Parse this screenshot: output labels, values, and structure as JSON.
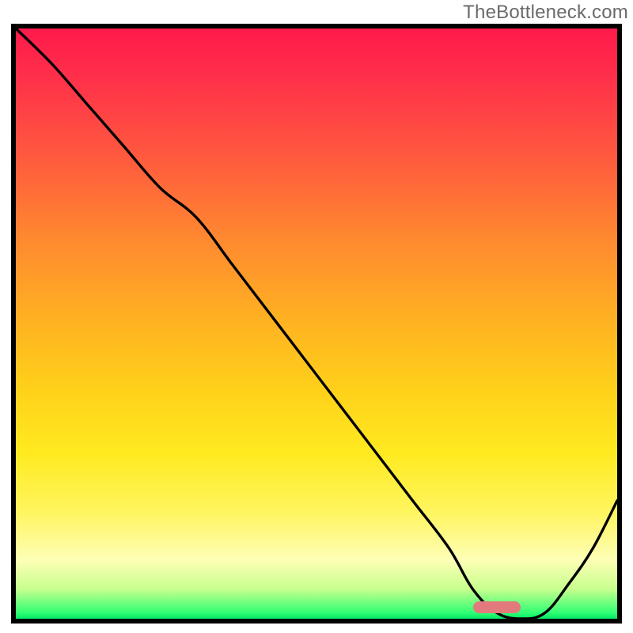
{
  "watermark": "TheBottleneck.com",
  "chart_data": {
    "type": "line",
    "title": "",
    "xlabel": "",
    "ylabel": "",
    "xlim": [
      0,
      100
    ],
    "ylim": [
      0,
      100
    ],
    "x": [
      0,
      6,
      12,
      18,
      24,
      30,
      36,
      42,
      48,
      54,
      60,
      66,
      72,
      76,
      80,
      84,
      88,
      92,
      96,
      100
    ],
    "y": [
      100,
      94,
      87,
      80,
      73,
      68,
      60,
      52,
      44,
      36,
      28,
      20,
      12,
      5,
      1,
      0,
      1,
      6,
      12,
      20
    ],
    "gradient_stops": [
      {
        "pos": 0.0,
        "color": "#ff1a4b"
      },
      {
        "pos": 0.22,
        "color": "#ff5a3e"
      },
      {
        "pos": 0.5,
        "color": "#ffb321"
      },
      {
        "pos": 0.72,
        "color": "#ffea20"
      },
      {
        "pos": 0.9,
        "color": "#feffb6"
      },
      {
        "pos": 0.99,
        "color": "#2fff74"
      },
      {
        "pos": 1.0,
        "color": "#02e765"
      }
    ],
    "marker": {
      "x_center": 80,
      "y": 2,
      "width_pct": 8,
      "height_pct": 2,
      "color": "#e27a7d"
    },
    "curve_knee": {
      "x": 24,
      "y": 73
    }
  }
}
